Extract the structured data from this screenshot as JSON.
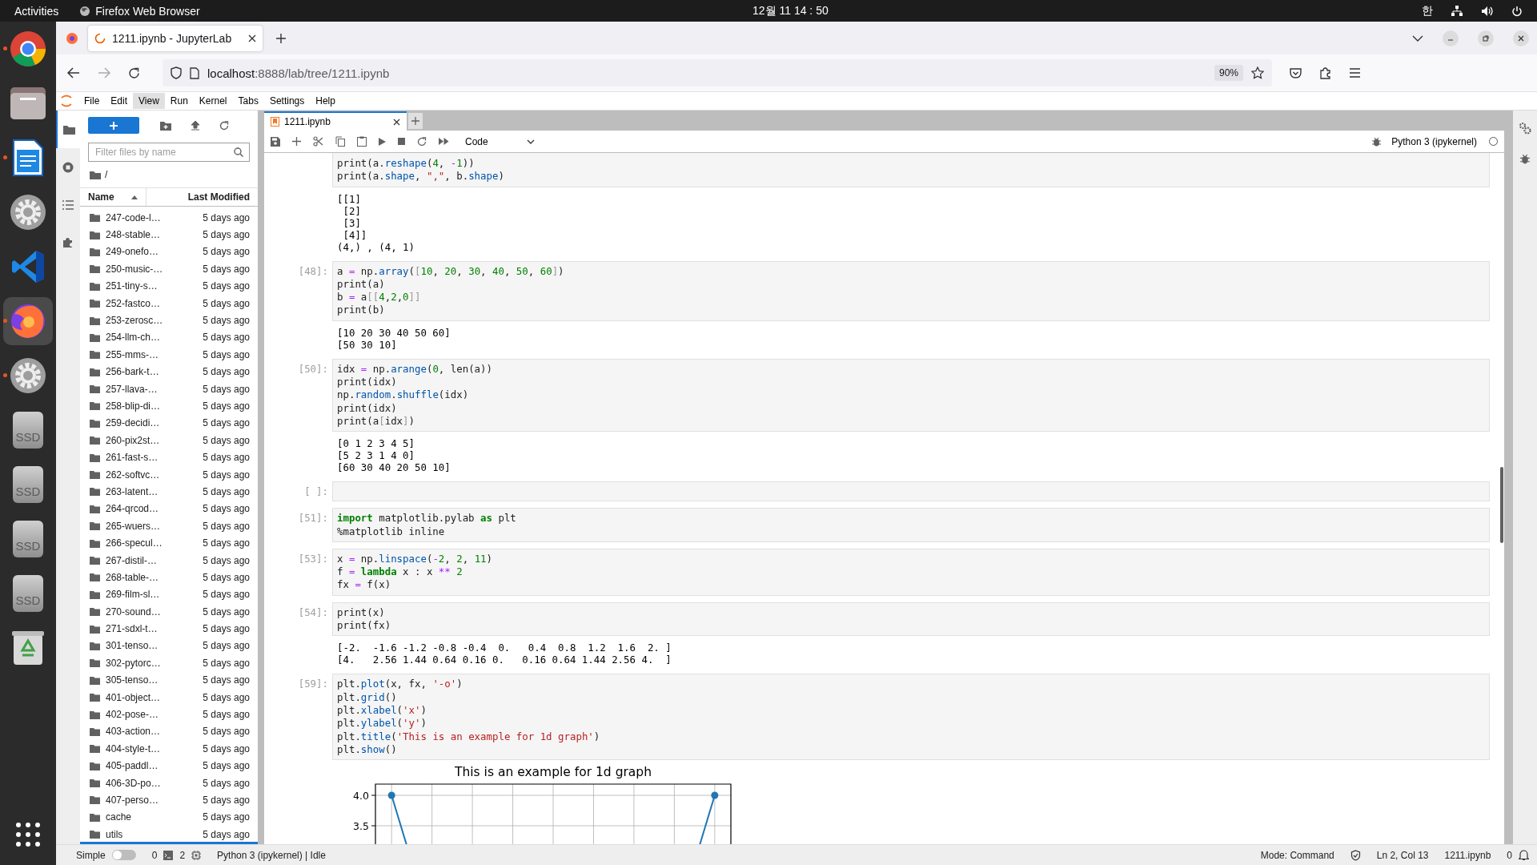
{
  "top_bar": {
    "activities": "Activities",
    "app_name": "Firefox Web Browser",
    "clock": "12월 11 14 : 50",
    "input_method": "한"
  },
  "dock": [
    {
      "running": true,
      "selected": false
    },
    {
      "running": false,
      "selected": false
    },
    {
      "running": true,
      "selected": false
    },
    {
      "running": false,
      "selected": false
    },
    {
      "running": false,
      "selected": false
    },
    {
      "running": true,
      "selected": true
    },
    {
      "running": true,
      "selected": false
    },
    {
      "running": false,
      "selected": false,
      "label": "SSD"
    },
    {
      "running": false,
      "selected": false,
      "label": "SSD"
    },
    {
      "running": false,
      "selected": false,
      "label": "SSD"
    },
    {
      "running": false,
      "selected": false,
      "label": "SSD"
    },
    {
      "running": false,
      "selected": false
    },
    {
      "running": false,
      "selected": false
    }
  ],
  "browser": {
    "tab": {
      "title": "1211.ipynb - JupyterLab",
      "loading": true
    },
    "url_host": "localhost",
    "url_path": ":8888/lab/tree/1211.ipynb",
    "zoom": "90%",
    "forward_disabled": true
  },
  "menu": [
    {
      "label": "File",
      "selected": false
    },
    {
      "label": "Edit",
      "selected": false
    },
    {
      "label": "View",
      "selected": true
    },
    {
      "label": "Run",
      "selected": false
    },
    {
      "label": "Kernel",
      "selected": false
    },
    {
      "label": "Tabs",
      "selected": false
    },
    {
      "label": "Settings",
      "selected": false
    },
    {
      "label": "Help",
      "selected": false
    }
  ],
  "file_browser": {
    "filter_placeholder": "Filter files by name",
    "path": "/",
    "columns": [
      {
        "label": "Name",
        "sorted": true
      },
      {
        "label": "Last Modified",
        "sorted": false
      }
    ],
    "rows": [
      {
        "name": "247-code-l…",
        "modified": "5 days ago"
      },
      {
        "name": "248-stable…",
        "modified": "5 days ago"
      },
      {
        "name": "249-onefo…",
        "modified": "5 days ago"
      },
      {
        "name": "250-music-…",
        "modified": "5 days ago"
      },
      {
        "name": "251-tiny-s…",
        "modified": "5 days ago"
      },
      {
        "name": "252-fastco…",
        "modified": "5 days ago"
      },
      {
        "name": "253-zerosc…",
        "modified": "5 days ago"
      },
      {
        "name": "254-llm-ch…",
        "modified": "5 days ago"
      },
      {
        "name": "255-mms-…",
        "modified": "5 days ago"
      },
      {
        "name": "256-bark-t…",
        "modified": "5 days ago"
      },
      {
        "name": "257-llava-…",
        "modified": "5 days ago"
      },
      {
        "name": "258-blip-di…",
        "modified": "5 days ago"
      },
      {
        "name": "259-decidi…",
        "modified": "5 days ago"
      },
      {
        "name": "260-pix2st…",
        "modified": "5 days ago"
      },
      {
        "name": "261-fast-s…",
        "modified": "5 days ago"
      },
      {
        "name": "262-softvc…",
        "modified": "5 days ago"
      },
      {
        "name": "263-latent…",
        "modified": "5 days ago"
      },
      {
        "name": "264-qrcod…",
        "modified": "5 days ago"
      },
      {
        "name": "265-wuers…",
        "modified": "5 days ago"
      },
      {
        "name": "266-specul…",
        "modified": "5 days ago"
      },
      {
        "name": "267-distil-…",
        "modified": "5 days ago"
      },
      {
        "name": "268-table-…",
        "modified": "5 days ago"
      },
      {
        "name": "269-film-sl…",
        "modified": "5 days ago"
      },
      {
        "name": "270-sound…",
        "modified": "5 days ago"
      },
      {
        "name": "271-sdxl-t…",
        "modified": "5 days ago"
      },
      {
        "name": "301-tenso…",
        "modified": "5 days ago"
      },
      {
        "name": "302-pytorc…",
        "modified": "5 days ago"
      },
      {
        "name": "305-tenso…",
        "modified": "5 days ago"
      },
      {
        "name": "401-object…",
        "modified": "5 days ago"
      },
      {
        "name": "402-pose-…",
        "modified": "5 days ago"
      },
      {
        "name": "403-action…",
        "modified": "5 days ago"
      },
      {
        "name": "404-style-t…",
        "modified": "5 days ago"
      },
      {
        "name": "405-paddl…",
        "modified": "5 days ago"
      },
      {
        "name": "406-3D-po…",
        "modified": "5 days ago"
      },
      {
        "name": "407-perso…",
        "modified": "5 days ago"
      },
      {
        "name": "cache",
        "modified": "5 days ago"
      },
      {
        "name": "utils",
        "modified": "5 days ago"
      }
    ]
  },
  "notebook": {
    "tab": {
      "title": "1211.ipynb",
      "selected": true
    },
    "cell_type": "Code",
    "kernel": "Python 3 (ipykernel)",
    "kernel_busy": false,
    "cells": [
      {
        "code": [
          [
            {
              "text": "print(a.",
              "kind": "plain"
            },
            {
              "text": "reshape",
              "kind": "prop"
            },
            {
              "text": "(",
              "kind": "plain"
            },
            {
              "text": "4",
              "kind": "num"
            },
            {
              "text": ", ",
              "kind": "plain"
            },
            {
              "text": "-",
              "kind": "op"
            },
            {
              "text": "1",
              "kind": "num"
            },
            {
              "text": "))",
              "kind": "plain"
            }
          ],
          [
            {
              "text": "print(a.",
              "kind": "plain"
            },
            {
              "text": "shape",
              "kind": "prop"
            },
            {
              "text": ", ",
              "kind": "plain"
            },
            {
              "text": "\",\"",
              "kind": "str"
            },
            {
              "text": ", b.",
              "kind": "plain"
            },
            {
              "text": "shape",
              "kind": "prop"
            },
            {
              "text": ")",
              "kind": "plain"
            }
          ]
        ],
        "output": [
          "[[1]",
          " [2]",
          " [3]",
          " [4]]",
          "(4,) , (4, 1)"
        ]
      },
      {
        "prompt": "[48]:",
        "code": [
          [
            {
              "text": "a ",
              "kind": "plain"
            },
            {
              "text": "=",
              "kind": "op"
            },
            {
              "text": " np.",
              "kind": "plain"
            },
            {
              "text": "array",
              "kind": "prop"
            },
            {
              "text": "(",
              "kind": "plain"
            },
            {
              "text": "[",
              "kind": "dim"
            },
            {
              "text": "10",
              "kind": "num"
            },
            {
              "text": ", ",
              "kind": "plain"
            },
            {
              "text": "20",
              "kind": "num"
            },
            {
              "text": ", ",
              "kind": "plain"
            },
            {
              "text": "30",
              "kind": "num"
            },
            {
              "text": ", ",
              "kind": "plain"
            },
            {
              "text": "40",
              "kind": "num"
            },
            {
              "text": ", ",
              "kind": "plain"
            },
            {
              "text": "50",
              "kind": "num"
            },
            {
              "text": ", ",
              "kind": "plain"
            },
            {
              "text": "60",
              "kind": "num"
            },
            {
              "text": "]",
              "kind": "dim"
            },
            {
              "text": ")",
              "kind": "plain"
            }
          ],
          [
            {
              "text": "print(a)",
              "kind": "plain"
            }
          ],
          [
            {
              "text": "b ",
              "kind": "plain"
            },
            {
              "text": "=",
              "kind": "op"
            },
            {
              "text": " a",
              "kind": "plain"
            },
            {
              "text": "[[",
              "kind": "dim"
            },
            {
              "text": "4",
              "kind": "num"
            },
            {
              "text": ",",
              "kind": "plain"
            },
            {
              "text": "2",
              "kind": "num"
            },
            {
              "text": ",",
              "kind": "plain"
            },
            {
              "text": "0",
              "kind": "num"
            },
            {
              "text": "]]",
              "kind": "dim"
            }
          ],
          [
            {
              "text": "print(b)",
              "kind": "plain"
            }
          ]
        ],
        "output": [
          "[10 20 30 40 50 60]",
          "[50 30 10]"
        ]
      },
      {
        "prompt": "[50]:",
        "code": [
          [
            {
              "text": "idx ",
              "kind": "plain"
            },
            {
              "text": "=",
              "kind": "op"
            },
            {
              "text": " np.",
              "kind": "plain"
            },
            {
              "text": "arange",
              "kind": "prop"
            },
            {
              "text": "(",
              "kind": "plain"
            },
            {
              "text": "0",
              "kind": "num"
            },
            {
              "text": ", len(a))",
              "kind": "plain"
            }
          ],
          [
            {
              "text": "print(idx)",
              "kind": "plain"
            }
          ],
          [
            {
              "text": "np.",
              "kind": "plain"
            },
            {
              "text": "random",
              "kind": "prop"
            },
            {
              "text": ".",
              "kind": "plain"
            },
            {
              "text": "shuffle",
              "kind": "prop"
            },
            {
              "text": "(idx)",
              "kind": "plain"
            }
          ],
          [
            {
              "text": "print(idx)",
              "kind": "plain"
            }
          ],
          [
            {
              "text": "print(a",
              "kind": "plain"
            },
            {
              "text": "[",
              "kind": "dim"
            },
            {
              "text": "idx",
              "kind": "plain"
            },
            {
              "text": "]",
              "kind": "dim"
            },
            {
              "text": ")",
              "kind": "plain"
            }
          ]
        ],
        "output": [
          "[0 1 2 3 4 5]",
          "[5 2 3 1 4 0]",
          "[60 30 40 20 50 10]"
        ]
      },
      {
        "prompt": "[ ]:"
      },
      {
        "prompt": "[51]:",
        "code": [
          [
            {
              "text": "import",
              "kind": "kw"
            },
            {
              "text": " matplotlib.pylab ",
              "kind": "plain"
            },
            {
              "text": "as",
              "kind": "kw"
            },
            {
              "text": " plt",
              "kind": "plain"
            }
          ],
          [
            {
              "text": "%matplotlib inline",
              "kind": "plain"
            }
          ]
        ]
      },
      {
        "prompt": "[53]:",
        "code": [
          [
            {
              "text": "x ",
              "kind": "plain"
            },
            {
              "text": "=",
              "kind": "op"
            },
            {
              "text": " np.",
              "kind": "plain"
            },
            {
              "text": "linspace",
              "kind": "prop"
            },
            {
              "text": "(",
              "kind": "plain"
            },
            {
              "text": "-",
              "kind": "op"
            },
            {
              "text": "2",
              "kind": "num"
            },
            {
              "text": ", ",
              "kind": "plain"
            },
            {
              "text": "2",
              "kind": "num"
            },
            {
              "text": ", ",
              "kind": "plain"
            },
            {
              "text": "11",
              "kind": "num"
            },
            {
              "text": ")",
              "kind": "plain"
            }
          ],
          [
            {
              "text": "f ",
              "kind": "plain"
            },
            {
              "text": "=",
              "kind": "op"
            },
            {
              "text": " lambda",
              "kind": "kw"
            },
            {
              "text": " x : x ",
              "kind": "plain"
            },
            {
              "text": "**",
              "kind": "op"
            },
            {
              "text": " 2",
              "kind": "num"
            }
          ],
          [
            {
              "text": "fx ",
              "kind": "plain"
            },
            {
              "text": "=",
              "kind": "op"
            },
            {
              "text": " f(x)",
              "kind": "plain"
            }
          ]
        ]
      },
      {
        "prompt": "[54]:",
        "code": [
          [
            {
              "text": "print(x)",
              "kind": "plain"
            }
          ],
          [
            {
              "text": "print(fx)",
              "kind": "plain"
            }
          ]
        ],
        "output": [
          "[-2.  -1.6 -1.2 -0.8 -0.4  0.   0.4  0.8  1.2  1.6  2. ]",
          "[4.   2.56 1.44 0.64 0.16 0.   0.16 0.64 1.44 2.56 4.  ]"
        ]
      },
      {
        "prompt": "[59]:",
        "code": [
          [
            {
              "text": "plt.",
              "kind": "plain"
            },
            {
              "text": "plot",
              "kind": "prop"
            },
            {
              "text": "(x, fx, ",
              "kind": "plain"
            },
            {
              "text": "'-o'",
              "kind": "str"
            },
            {
              "text": ")",
              "kind": "plain"
            }
          ],
          [
            {
              "text": "plt.",
              "kind": "plain"
            },
            {
              "text": "grid",
              "kind": "prop"
            },
            {
              "text": "()",
              "kind": "plain"
            }
          ],
          [
            {
              "text": "plt.",
              "kind": "plain"
            },
            {
              "text": "xlabel",
              "kind": "prop"
            },
            {
              "text": "(",
              "kind": "plain"
            },
            {
              "text": "'x'",
              "kind": "str"
            },
            {
              "text": ")",
              "kind": "plain"
            }
          ],
          [
            {
              "text": "plt.",
              "kind": "plain"
            },
            {
              "text": "ylabel",
              "kind": "prop"
            },
            {
              "text": "(",
              "kind": "plain"
            },
            {
              "text": "'y'",
              "kind": "str"
            },
            {
              "text": ")",
              "kind": "plain"
            }
          ],
          [
            {
              "text": "plt.",
              "kind": "plain"
            },
            {
              "text": "title",
              "kind": "prop"
            },
            {
              "text": "(",
              "kind": "plain"
            },
            {
              "text": "'This is an example for 1d graph'",
              "kind": "str"
            },
            {
              "text": ")",
              "kind": "plain"
            }
          ],
          [
            {
              "text": "plt.",
              "kind": "plain"
            },
            {
              "text": "show",
              "kind": "prop"
            },
            {
              "text": "()",
              "kind": "plain"
            }
          ]
        ],
        "plot": {
          "title": "This is an example for 1d graph",
          "y_tick_labels": [
            "4.0",
            "3.5"
          ]
        }
      }
    ]
  },
  "status_bar": {
    "simple_label": "Simple",
    "simple_on": false,
    "terminals": "0",
    "kernels": "2",
    "kernel_status": "Python 3 (ipykernel) | Idle",
    "mode": "Mode: Command",
    "cursor": "Ln 2, Col 13",
    "file": "1211.ipynb",
    "notifications": "0"
  }
}
